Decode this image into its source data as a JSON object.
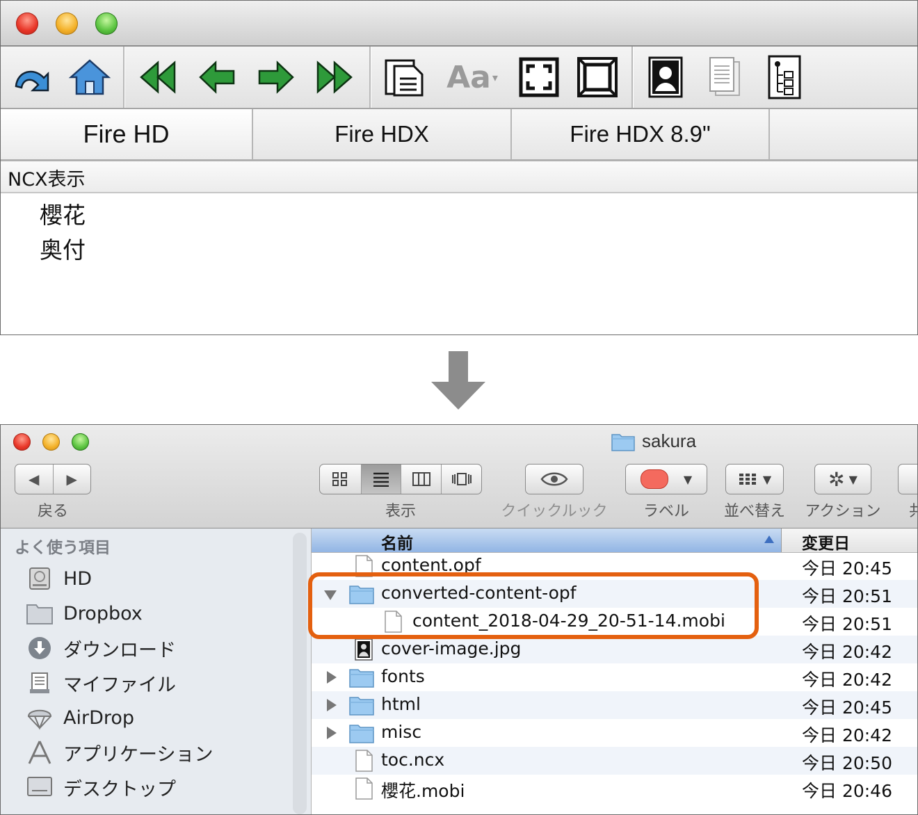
{
  "top_window": {
    "tabs": [
      "Fire HD",
      "Fire HDX",
      "Fire HDX 8.9\""
    ],
    "toolbar": {
      "buttons": [
        "undo-icon",
        "home-icon",
        "first-page-icon",
        "previous-page-icon",
        "next-page-icon",
        "last-page-icon",
        "page-layout-icon",
        "font-size-icon",
        "fit-screen-icon",
        "fullscreen-icon",
        "cover-image-icon",
        "page-view-icon",
        "ncx-view-icon"
      ],
      "font_button_label": "Aa"
    },
    "ncx_header": "NCX表示",
    "ncx_items": [
      "櫻花",
      "奥付"
    ]
  },
  "finder": {
    "title": "sakura",
    "toolbar": {
      "back_label": "戻る",
      "view_label": "表示",
      "quicklook_label": "クイックルック",
      "label_label": "ラベル",
      "arrange_label": "並べ替え",
      "action_label": "アクション",
      "share_label_partial": "共"
    },
    "sidebar": {
      "heading": "よく使う項目",
      "items": [
        "HD",
        "Dropbox",
        "ダウンロード",
        "マイファイル",
        "AirDrop",
        "アプリケーション",
        "デスクトップ"
      ]
    },
    "columns": {
      "name": "名前",
      "date": "変更日"
    },
    "rows": [
      {
        "name": "content.opf",
        "date": "今日 20:45",
        "kind": "file",
        "indent": 0
      },
      {
        "name": "converted-content-opf",
        "date": "今日 20:51",
        "kind": "folder-open",
        "indent": 0
      },
      {
        "name": "content_2018-04-29_20-51-14.mobi",
        "date": "今日 20:51",
        "kind": "file",
        "indent": 1
      },
      {
        "name": "cover-image.jpg",
        "date": "今日 20:42",
        "kind": "image",
        "indent": 0
      },
      {
        "name": "fonts",
        "date": "今日 20:42",
        "kind": "folder",
        "indent": 0
      },
      {
        "name": "html",
        "date": "今日 20:45",
        "kind": "folder",
        "indent": 0
      },
      {
        "name": "misc",
        "date": "今日 20:42",
        "kind": "folder",
        "indent": 0
      },
      {
        "name": "toc.ncx",
        "date": "今日 20:50",
        "kind": "file",
        "indent": 0
      },
      {
        "name": "櫻花.mobi",
        "date": "今日 20:46",
        "kind": "file",
        "indent": 0
      }
    ],
    "highlight_color": "#e4600f"
  }
}
